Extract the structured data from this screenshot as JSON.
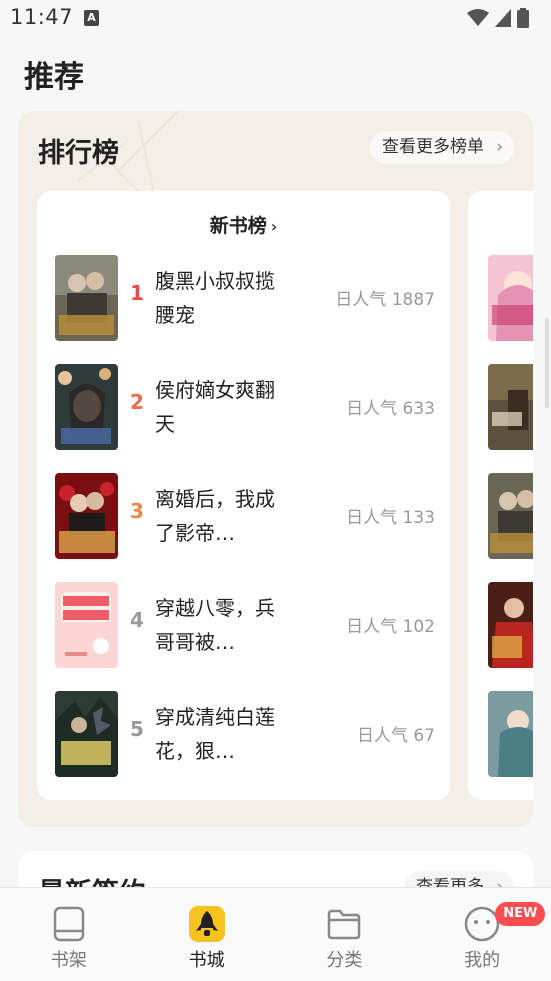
{
  "status": {
    "time": "11:47",
    "app_icon": "A"
  },
  "page_title": "推荐",
  "ranking": {
    "title": "排行榜",
    "more_label": "查看更多榜单",
    "list_title": "新书榜",
    "books": [
      {
        "rank": "1",
        "title": "腹黑小叔叔揽腰宠",
        "popularity": "日人气 1887",
        "rank_color": "#e84b4b"
      },
      {
        "rank": "2",
        "title": "侯府嫡女爽翻天",
        "popularity": "日人气 633",
        "rank_color": "#f06a4a"
      },
      {
        "rank": "3",
        "title": "离婚后，我成了影帝…",
        "popularity": "日人气 133",
        "rank_color": "#f3814c"
      },
      {
        "rank": "4",
        "title": "穿越八零，兵哥哥被…",
        "popularity": "日人气 102",
        "rank_color": "#999999"
      },
      {
        "rank": "5",
        "title": "穿成清纯白莲花，狠…",
        "popularity": "日人气 67",
        "rank_color": "#999999"
      }
    ]
  },
  "signed": {
    "title": "最新签约",
    "more_label": "查看更多"
  },
  "nav": [
    {
      "label": "书架",
      "icon": "bookshelf-icon",
      "active": false
    },
    {
      "label": "书城",
      "icon": "rocket-icon",
      "active": true
    },
    {
      "label": "分类",
      "icon": "folder-icon",
      "active": false
    },
    {
      "label": "我的",
      "icon": "profile-icon",
      "active": false,
      "badge": "NEW"
    }
  ],
  "colors": {
    "accent": "#f7c31f",
    "badge": "#ff4d4f",
    "card_bg": "#f3efe7"
  }
}
